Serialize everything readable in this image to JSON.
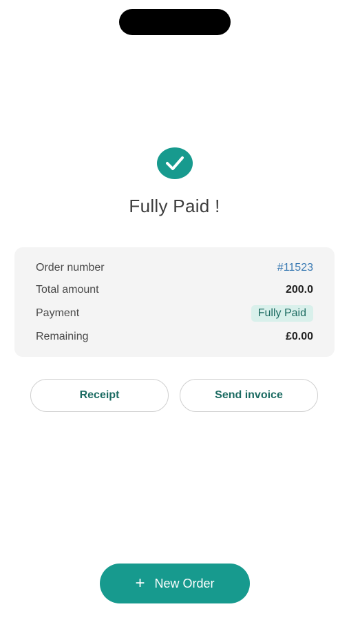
{
  "status": {
    "title": "Fully Paid !",
    "icon": "check-circle-icon",
    "accent_color": "#179a8e"
  },
  "summary": {
    "rows": [
      {
        "label": "Order number",
        "value": "#11523"
      },
      {
        "label": "Total amount",
        "value": "200.0"
      },
      {
        "label": "Payment",
        "value": "Fully Paid"
      },
      {
        "label": "Remaining",
        "value": "£0.00"
      }
    ]
  },
  "actions": {
    "receipt_label": "Receipt",
    "send_invoice_label": "Send invoice"
  },
  "footer": {
    "new_order_label": "New Order",
    "new_order_icon": "plus-icon"
  }
}
